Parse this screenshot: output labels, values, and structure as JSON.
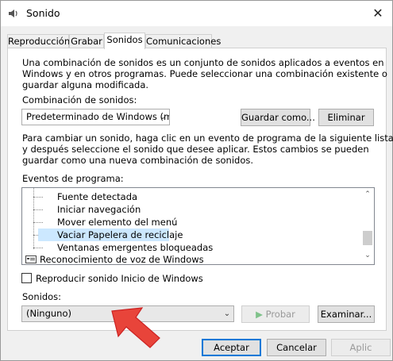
{
  "window": {
    "title": "Sonido"
  },
  "tabs": [
    "Reproducción",
    "Grabar",
    "Sonidos",
    "Comunicaciones"
  ],
  "active_tab": "Sonidos",
  "panel": {
    "intro_lines": [
      "Una combinación de sonidos es un conjunto de sonidos aplicados a eventos en",
      "Windows y en otros programas. Puede seleccionar una combinación existente o",
      "guardar alguna modificada."
    ],
    "scheme_label": "Combinación de sonidos:",
    "scheme_value": "Predeterminado de Windows (m",
    "save_as": "Guardar como...",
    "delete": "Eliminar",
    "help_lines": [
      "Para cambiar un sonido, haga clic en un evento de programa de la siguiente lista",
      "y después seleccione el sonido que desee aplicar. Estos cambios se pueden",
      "guardar como una nueva combinación de sonidos."
    ],
    "events_label": "Eventos de programa:",
    "events": [
      {
        "label": "Fuente detectada"
      },
      {
        "label": "Iniciar navegación"
      },
      {
        "label": "Mover elemento del menú"
      },
      {
        "label": "Vaciar Papelera de reciclaje",
        "selected": true
      },
      {
        "label": "Ventanas emergentes bloqueadas"
      },
      {
        "label": "Reconocimiento de voz de Windows",
        "group": true
      }
    ],
    "startup_checkbox": "Reproducir sonido Inicio de Windows",
    "startup_checked": false,
    "sounds_label": "Sonidos:",
    "sounds_value": "(Ninguno)",
    "test": "Probar",
    "browse": "Examinar..."
  },
  "footer": {
    "ok": "Aceptar",
    "cancel": "Cancelar",
    "apply": "Aplic"
  },
  "colors": {
    "selection": "#cce8ff",
    "arrow": "#e8443a",
    "play_disabled": "#7fc28a"
  }
}
